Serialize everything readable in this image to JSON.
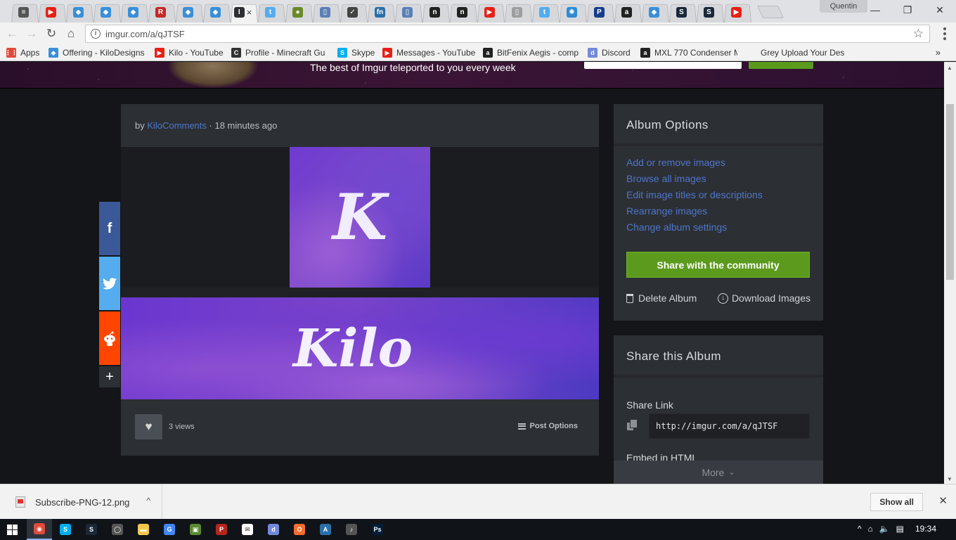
{
  "browser": {
    "tabs": [
      {
        "icon": "chrome-menu-icon",
        "color": "#555555",
        "glyph": "≡"
      },
      {
        "icon": "youtube-icon",
        "color": "#e62117",
        "glyph": "▶"
      },
      {
        "icon": "kilodesigns-icon",
        "color": "#3a8fd8",
        "glyph": "◆"
      },
      {
        "icon": "kilodesigns-icon",
        "color": "#3a8fd8",
        "glyph": "◆"
      },
      {
        "icon": "kilodesigns-icon",
        "color": "#3a8fd8",
        "glyph": "◆"
      },
      {
        "icon": "rugged-icon",
        "color": "#c62828",
        "glyph": "R"
      },
      {
        "icon": "kilodesigns-icon",
        "color": "#3a8fd8",
        "glyph": "◆"
      },
      {
        "icon": "kilodesigns-icon",
        "color": "#3a8fd8",
        "glyph": "◆"
      },
      {
        "icon": "imgur-icon",
        "color": "#2c2f34",
        "glyph": "I",
        "active": true
      },
      {
        "icon": "twitter-icon",
        "color": "#55acee",
        "glyph": "t"
      },
      {
        "icon": "green-app-icon",
        "color": "#6a8a2a",
        "glyph": "●"
      },
      {
        "icon": "document-icon",
        "color": "#5a7fb6",
        "glyph": "▯"
      },
      {
        "icon": "checkbox-icon",
        "color": "#444444",
        "glyph": "✓"
      },
      {
        "icon": "fn-icon",
        "color": "#2b6fa8",
        "glyph": "fn"
      },
      {
        "icon": "document-icon",
        "color": "#5a7fb6",
        "glyph": "▯"
      },
      {
        "icon": "n-icon",
        "color": "#222222",
        "glyph": "n"
      },
      {
        "icon": "n-icon",
        "color": "#222222",
        "glyph": "n"
      },
      {
        "icon": "youtube-icon",
        "color": "#e62117",
        "glyph": "▶"
      },
      {
        "icon": "blank-page-icon",
        "color": "#9e9e9e",
        "glyph": "▯"
      },
      {
        "icon": "twitter-icon",
        "color": "#55acee",
        "glyph": "t"
      },
      {
        "icon": "react-icon",
        "color": "#2e8bd6",
        "glyph": "✺"
      },
      {
        "icon": "paypal-icon",
        "color": "#173d8c",
        "glyph": "P"
      },
      {
        "icon": "amazon-icon",
        "color": "#222222",
        "glyph": "a"
      },
      {
        "icon": "kilodesigns-icon",
        "color": "#3a8fd8",
        "glyph": "◆"
      },
      {
        "icon": "steam-icon",
        "color": "#1b2838",
        "glyph": "S"
      },
      {
        "icon": "steam-icon",
        "color": "#1b2838",
        "glyph": "S"
      },
      {
        "icon": "youtube-icon",
        "color": "#e62117",
        "glyph": "▶"
      }
    ],
    "active_tab_close": "×",
    "profile_name": "Quentin",
    "window_buttons": {
      "minimize": "—",
      "maximize": "❐",
      "close": "✕"
    },
    "nav": {
      "back": "←",
      "forward": "→",
      "reload": "↻",
      "home": "⌂"
    },
    "url": "imgur.com/a/qJTSF",
    "bookmarks": [
      {
        "label": "Apps",
        "icon": "apps-grid-icon",
        "color": "#e04a3a",
        "glyph": "⋮⋮"
      },
      {
        "label": "Offering - KiloDesigns",
        "icon": "kilodesigns-icon",
        "color": "#3a8fd8",
        "glyph": "◆"
      },
      {
        "label": "Kilo - YouTube",
        "icon": "youtube-icon",
        "color": "#e62117",
        "glyph": "▶"
      },
      {
        "label": "Profile - Minecraft Gu",
        "icon": "minecraft-icon",
        "color": "#333333",
        "glyph": "C"
      },
      {
        "label": "Skype",
        "icon": "skype-icon",
        "color": "#00aff0",
        "glyph": "S"
      },
      {
        "label": "Messages - YouTube",
        "icon": "youtube-icon",
        "color": "#e62117",
        "glyph": "▶"
      },
      {
        "label": "BitFenix Aegis - comp",
        "icon": "amazon-icon",
        "color": "#222222",
        "glyph": "a"
      },
      {
        "label": "Discord",
        "icon": "discord-icon",
        "color": "#7289da",
        "glyph": "d"
      },
      {
        "label": "MXL 770 Condenser M",
        "icon": "amazon-icon",
        "color": "#222222",
        "glyph": "a"
      },
      {
        "label": "Grey Upload Your Des",
        "icon": "blank-icon",
        "color": "#f2f2f2",
        "glyph": ""
      }
    ],
    "bookmarks_overflow": "»"
  },
  "imgur": {
    "banner_tagline": "The best of Imgur teleported to you every week",
    "post": {
      "by": "by",
      "author": "KiloComments",
      "separator": "·",
      "time": "18 minutes ago",
      "image1_text": "K",
      "image2_text": "Kilo",
      "views": "3 views",
      "post_options": "Post Options"
    },
    "social": {
      "facebook": "f",
      "more": "+"
    },
    "album_options": {
      "title": "Album Options",
      "links": [
        "Add or remove images",
        "Browse all images",
        "Edit image titles or descriptions",
        "Rearrange images",
        "Change album settings"
      ],
      "share_button": "Share with the community",
      "delete": "Delete Album",
      "download": "Download Images"
    },
    "share_album": {
      "title": "Share this Album",
      "share_link_label": "Share Link",
      "share_link": "http://imgur.com/a/qJTSF",
      "embed_label": "Embed in HTML",
      "more": "More",
      "more_chevron": "⌄"
    }
  },
  "downloads": {
    "file": "Subscribe-PNG-12.png",
    "caret": "^",
    "show_all": "Show all",
    "close": "✕"
  },
  "taskbar": {
    "apps": [
      {
        "icon": "chrome-icon",
        "color": "#e04a3a",
        "glyph": "◉",
        "active": true
      },
      {
        "icon": "skype-icon",
        "color": "#00aff0",
        "glyph": "S"
      },
      {
        "icon": "steam-icon",
        "color": "#1b2838",
        "glyph": "S"
      },
      {
        "icon": "cortana-icon",
        "color": "#555555",
        "glyph": "◯"
      },
      {
        "icon": "file-explorer-icon",
        "color": "#f2c94c",
        "glyph": "▬"
      },
      {
        "icon": "google-icon",
        "color": "#4285f4",
        "glyph": "G"
      },
      {
        "icon": "minecraft-icon",
        "color": "#5b8a32",
        "glyph": "▣"
      },
      {
        "icon": "poker-icon",
        "color": "#b3261e",
        "glyph": "P"
      },
      {
        "icon": "mail-icon",
        "color": "#ffffff",
        "glyph": "✉"
      },
      {
        "icon": "discord-icon",
        "color": "#7289da",
        "glyph": "d"
      },
      {
        "icon": "origin-icon",
        "color": "#f56c2d",
        "glyph": "O"
      },
      {
        "icon": "app-icon",
        "color": "#2b6fa8",
        "glyph": "A"
      },
      {
        "icon": "audio-icon",
        "color": "#555555",
        "glyph": "♪"
      },
      {
        "icon": "photoshop-icon",
        "color": "#001e36",
        "glyph": "Ps"
      }
    ],
    "tray": [
      "^",
      "⌂",
      "🔈",
      "▤"
    ],
    "clock": "19:34"
  }
}
